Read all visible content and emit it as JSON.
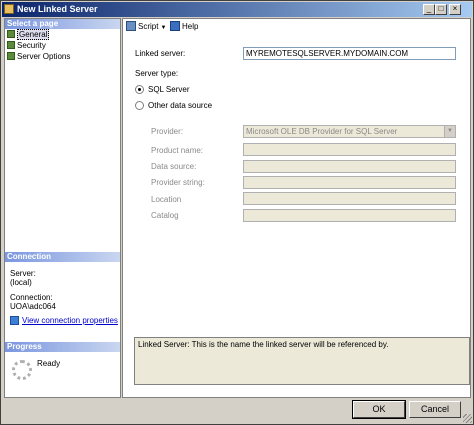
{
  "window": {
    "title": "New Linked Server"
  },
  "titlebar_buttons": {
    "minimize": "_",
    "maximize": "□",
    "close": "×"
  },
  "left": {
    "select_page_header": "Select a page",
    "pages": [
      {
        "label": "General",
        "icon": "page-icon"
      },
      {
        "label": "Security",
        "icon": "page-icon"
      },
      {
        "label": "Server Options",
        "icon": "page-icon"
      }
    ],
    "connection_header": "Connection",
    "server_label": "Server:",
    "server_value": "(local)",
    "connection_label": "Connection:",
    "connection_value": "UOA\\adc064",
    "view_connection_properties": "View connection properties",
    "progress_header": "Progress",
    "progress_status": "Ready"
  },
  "toolbar": {
    "script": "Script",
    "help": "Help"
  },
  "form": {
    "linked_server_label": "Linked server:",
    "linked_server_value": "MYREMOTESQLSERVER.MYDOMAIN.COM",
    "server_type_label": "Server type:",
    "sql_server_option": "SQL Server",
    "other_source_option": "Other data source",
    "provider_label": "Provider:",
    "provider_value": "Microsoft OLE DB Provider for SQL Server",
    "product_name_label": "Product name:",
    "data_source_label": "Data source:",
    "provider_string_label": "Provider string:",
    "location_label": "Location",
    "catalog_label": "Catalog",
    "product_name_value": "",
    "data_source_value": "",
    "provider_string_value": "",
    "location_value": "",
    "catalog_value": ""
  },
  "description": "Linked Server: This is the name the linked server will be referenced by.",
  "buttons": {
    "ok": "OK",
    "cancel": "Cancel"
  }
}
